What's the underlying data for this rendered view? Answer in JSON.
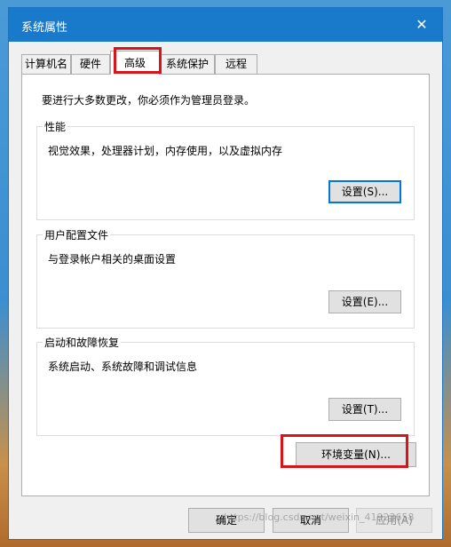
{
  "window": {
    "title": "系统属性",
    "close_glyph": "✕"
  },
  "tabs": [
    {
      "label": "计算机名"
    },
    {
      "label": "硬件"
    },
    {
      "label": "高级"
    },
    {
      "label": "系统保护"
    },
    {
      "label": "远程"
    }
  ],
  "active_tab": "高级",
  "panel": {
    "intro": "要进行大多数更改，你必须作为管理员登录。",
    "groups": [
      {
        "title": "性能",
        "description": "视觉效果，处理器计划，内存使用，以及虚拟内存",
        "button": "设置(S)..."
      },
      {
        "title": "用户配置文件",
        "description": "与登录帐户相关的桌面设置",
        "button": "设置(E)..."
      },
      {
        "title": "启动和故障恢复",
        "description": "系统启动、系统故障和调试信息",
        "button": "设置(T)..."
      }
    ],
    "env_button": "环境变量(N)..."
  },
  "footer": {
    "ok": "确定",
    "cancel": "取消",
    "apply": "应用(A)"
  },
  "watermark": "https://blog.csdn.net/weixin_41923658",
  "colors": {
    "titlebar": "#1979ca",
    "highlight": "#d8141b",
    "focus": "#0078d7"
  }
}
